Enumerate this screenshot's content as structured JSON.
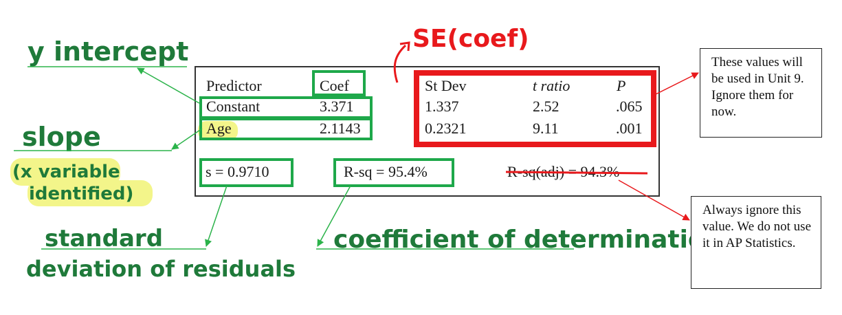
{
  "annotations": {
    "y_intercept": "y intercept",
    "se_coef": "SE(coef)",
    "slope": "slope",
    "slope_note_line1": "(x variable",
    "slope_note_line2": "identified)",
    "std_dev_line1": "standard",
    "std_dev_line2": "deviation of residuals",
    "coef_determination": "coefficient of determination"
  },
  "table": {
    "headers": [
      "Predictor",
      "Coef",
      "St Dev",
      "t ratio",
      "P"
    ],
    "rows": [
      [
        "Constant",
        "3.371",
        "1.337",
        "2.52",
        ".065"
      ],
      [
        "Age",
        "2.1143",
        "0.2321",
        "9.11",
        ".001"
      ]
    ],
    "s": "s = 0.9710",
    "rsq": "R-sq = 95.4%",
    "rsq_adj": "R-sq(adj) = 94.3%"
  },
  "notes": {
    "unit9": "These values will be used in Unit 9. Ignore them for now.",
    "ignore": "Always ignore this value. We do not use it in AP Statistics."
  },
  "colors": {
    "green_box": "#1ea84a",
    "red_box": "#e8191c",
    "handwriting": "#1f7a3a",
    "highlight": "#f3f58a",
    "arrow_green": "#2bb34a",
    "arrow_red": "#e8191c"
  }
}
